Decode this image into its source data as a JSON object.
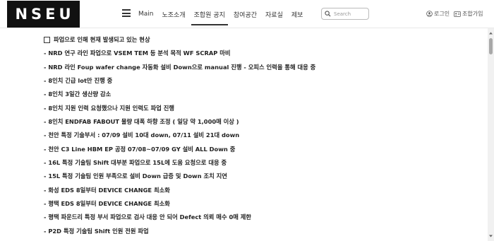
{
  "header": {
    "logo": "NSEU",
    "nav": [
      {
        "label": "Main",
        "active": false
      },
      {
        "label": "노조소개",
        "active": false
      },
      {
        "label": "조합원 공지",
        "active": true
      },
      {
        "label": "참여공간",
        "active": false
      },
      {
        "label": "자료실",
        "active": false
      },
      {
        "label": "제보",
        "active": false
      }
    ],
    "search_placeholder": "Search",
    "login_label": "로그인",
    "join_label": "조합가입"
  },
  "content": {
    "heading": "파업으로 인해 현재 발생되고 있는 현상",
    "items": [
      "- NRD 연구 라인 파업으로 VSEM TEM 등 분석 목적 WF SCRAP 마비",
      "- NRD 라인 Foup wafer change 자동화 설비 Down으로 manual 진행 - 오피스 인력을 통해 대응 중",
      "- 8인치 긴급 lot만 진행 중",
      "- 8인치 3일간 생산량 감소",
      "- 8인치 지원 인력 요청했으나 지원 인력도 파업 진행",
      "- 8인치 ENDFAB FABOUT 물량 대폭 하향 조정 ( 일당 약 1,000매 이상 )",
      "- 천안 특정 기술부서 : 07/09 설비 10대 down, 07/11 설비 21대 down",
      "- 천안 C3 Line HBM EP 공정 07/08~07/09 GY 설비 ALL Down 중",
      "- 16L 특정 기술팀 Shift 대부분 파업으로 15L에 도움 요청으로 대응 중",
      "- 15L 특정 기술팀 인원 부족으로 설비 Down 급증 및 Down 조치 지연",
      "- 화성 EDS 8일부터 DEVICE CHANGE 최소화",
      "- 평택 EDS 8일부터 DEVICE CHANGE 최소화",
      "- 평택 파운드리 특정 부서 파업으로 검사 대응 안 되어 Defect 의뢰 매수 0매 제한",
      "- P2D 특정 기술팀 Shift 인원 전원 파업"
    ]
  }
}
